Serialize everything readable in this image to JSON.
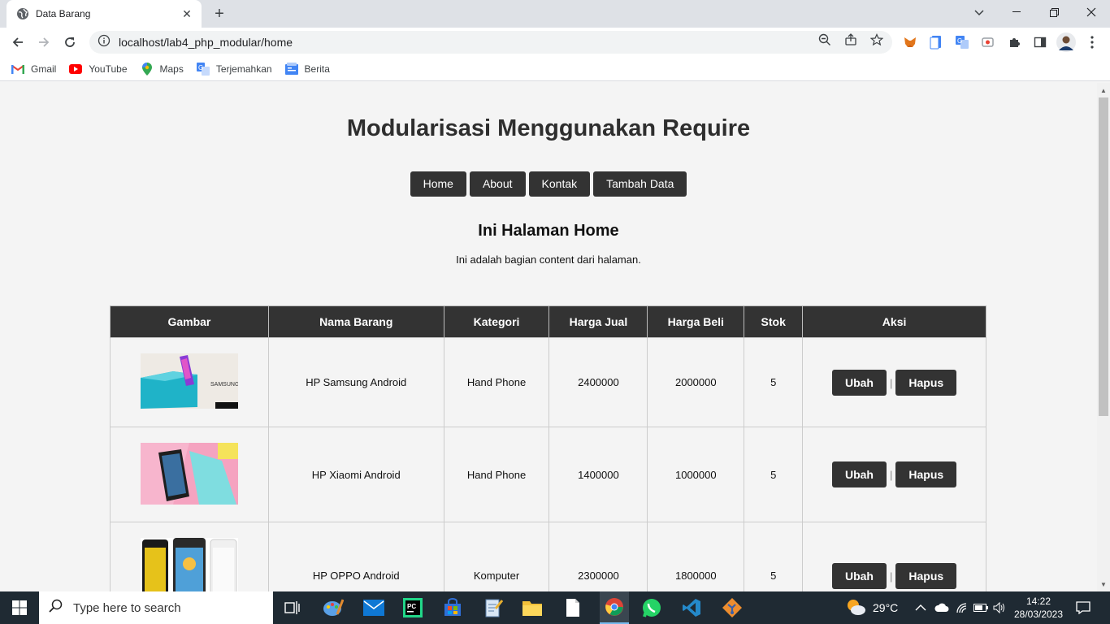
{
  "browser": {
    "tab_title": "Data Barang",
    "url": "localhost/lab4_php_modular/home",
    "bookmarks": [
      {
        "label": "Gmail",
        "icon": "gmail-icon"
      },
      {
        "label": "YouTube",
        "icon": "youtube-icon"
      },
      {
        "label": "Maps",
        "icon": "maps-icon"
      },
      {
        "label": "Terjemahkan",
        "icon": "translate-icon"
      },
      {
        "label": "Berita",
        "icon": "news-icon"
      }
    ]
  },
  "page": {
    "title": "Modularisasi Menggunakan Require",
    "nav": [
      "Home",
      "About",
      "Kontak",
      "Tambah Data"
    ],
    "subtitle": "Ini Halaman Home",
    "description": "Ini adalah bagian content dari halaman.",
    "table": {
      "headers": [
        "Gambar",
        "Nama Barang",
        "Kategori",
        "Harga Jual",
        "Harga Beli",
        "Stok",
        "Aksi"
      ],
      "rows": [
        {
          "image": "samsung-phone-image",
          "nama": "HP Samsung Android",
          "kategori": "Hand Phone",
          "harga_jual": "2400000",
          "harga_beli": "2000000",
          "stok": "5",
          "ubah": "Ubah",
          "hapus": "Hapus"
        },
        {
          "image": "xiaomi-phone-image",
          "nama": "HP Xiaomi Android",
          "kategori": "Hand Phone",
          "harga_jual": "1400000",
          "harga_beli": "1000000",
          "stok": "5",
          "ubah": "Ubah",
          "hapus": "Hapus"
        },
        {
          "image": "oppo-phone-image",
          "nama": "HP OPPO Android",
          "kategori": "Komputer",
          "harga_jual": "2300000",
          "harga_beli": "1800000",
          "stok": "5",
          "ubah": "Ubah",
          "hapus": "Hapus"
        }
      ],
      "separator": "|"
    }
  },
  "taskbar": {
    "search_placeholder": "Type here to search",
    "weather": "29°C",
    "time": "14:22",
    "date": "28/03/2023"
  },
  "colors": {
    "dark_button": "#333333",
    "page_bg": "#f4f4f4",
    "taskbar": "#1f2a33"
  }
}
